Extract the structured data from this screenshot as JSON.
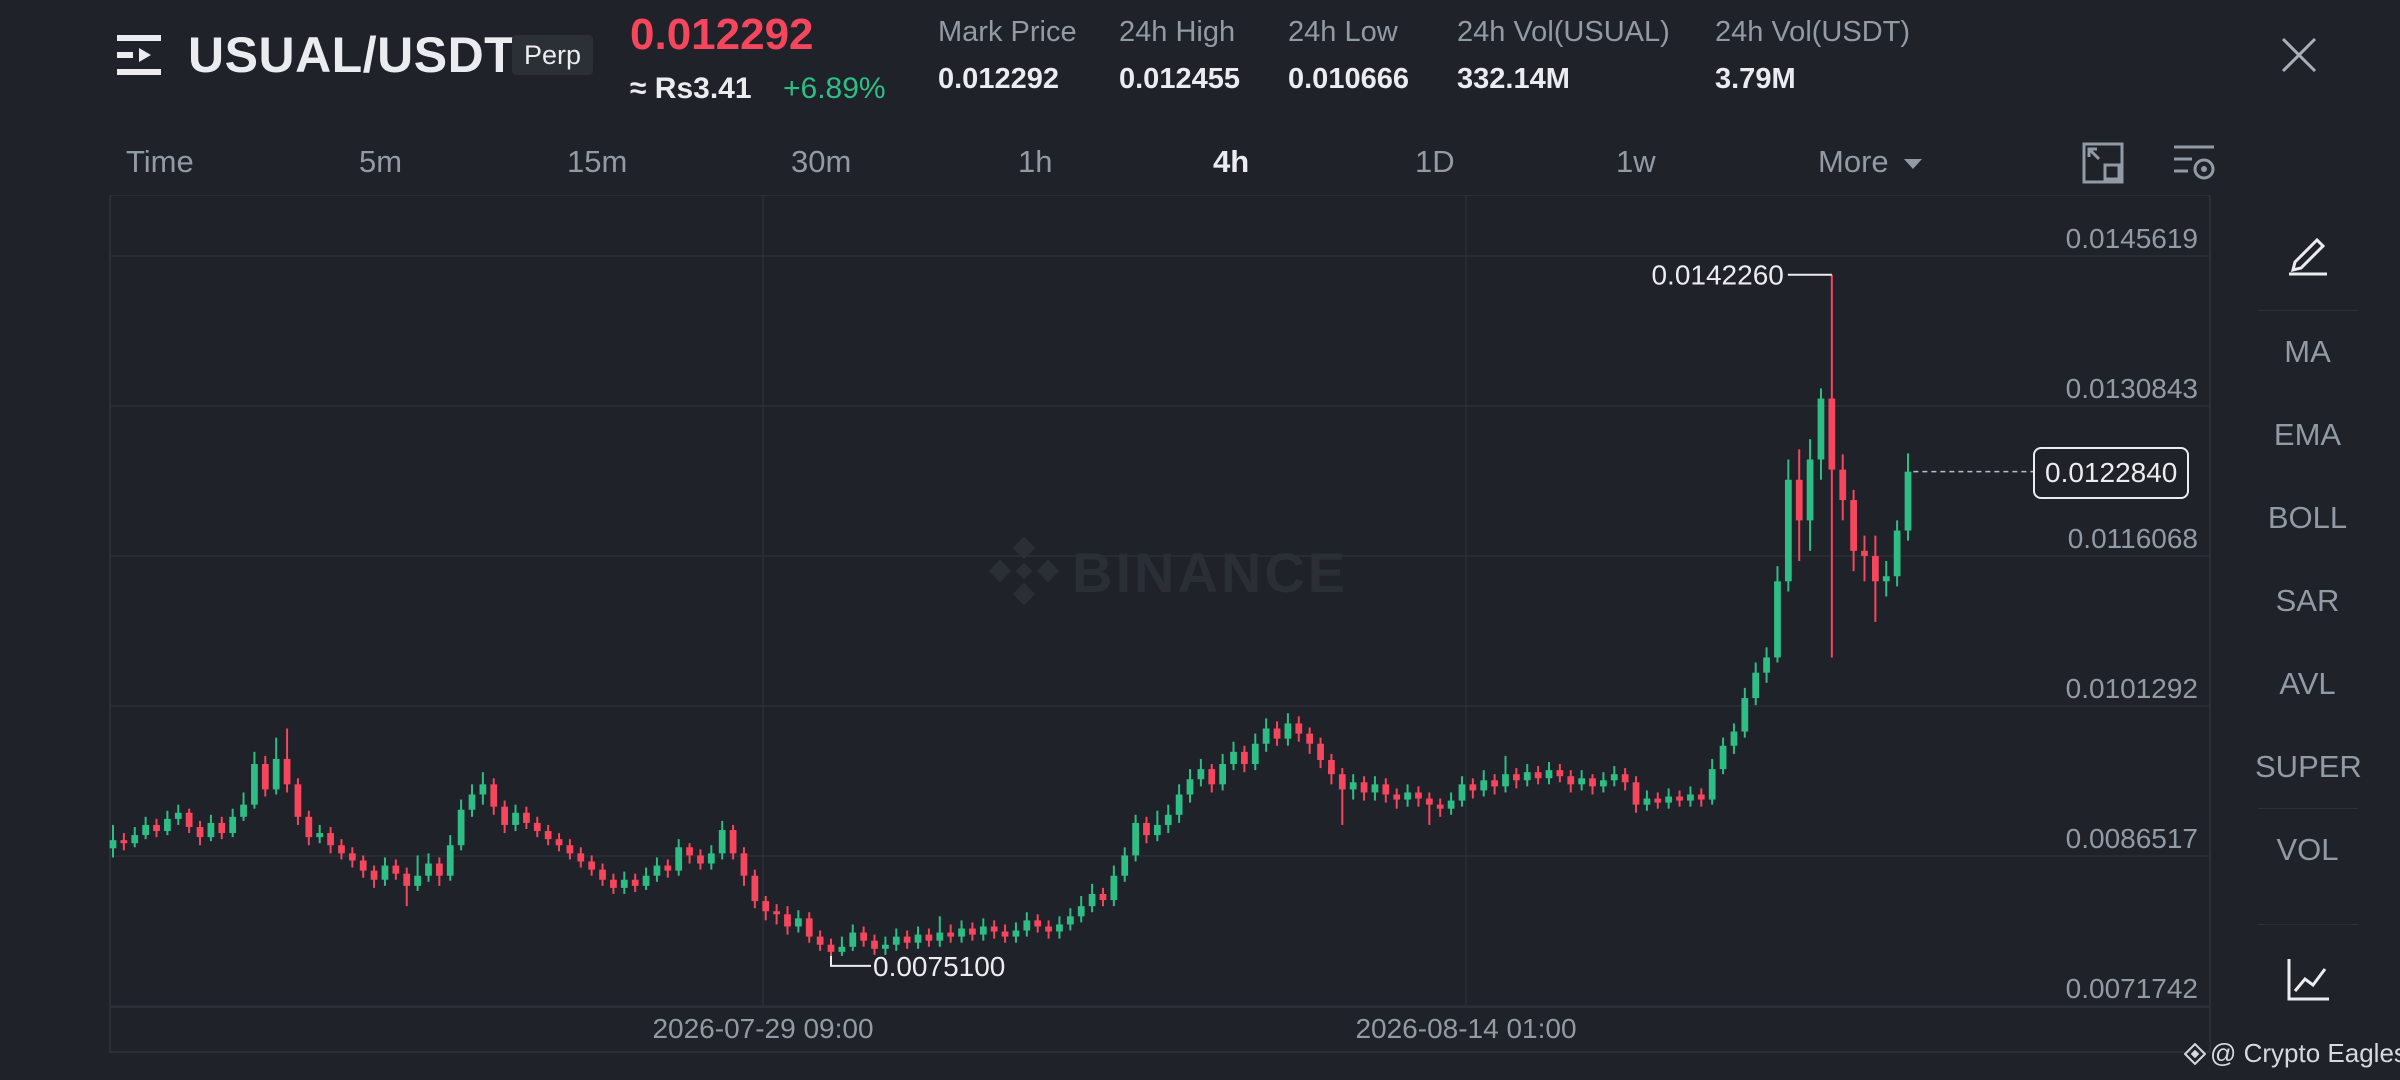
{
  "header": {
    "pair": "USUAL/USDT",
    "contract_badge": "Perp",
    "last_price": "0.012292",
    "fiat_price": "≈ Rs3.41",
    "change_pct": "+6.89%",
    "stats": [
      {
        "label": "Mark Price",
        "value": "0.012292"
      },
      {
        "label": "24h High",
        "value": "0.012455"
      },
      {
        "label": "24h Low",
        "value": "0.010666"
      },
      {
        "label": "24h Vol(USUAL)",
        "value": "332.14M"
      },
      {
        "label": "24h Vol(USDT)",
        "value": "3.79M"
      }
    ]
  },
  "timeframes": [
    "Time",
    "5m",
    "15m",
    "30m",
    "1h",
    "4h",
    "1D",
    "1w",
    "More"
  ],
  "active_timeframe": "4h",
  "indicators": [
    "MA",
    "EMA",
    "BOLL",
    "SAR",
    "AVL",
    "SUPER",
    "VOL"
  ],
  "icons": {
    "menu": "menu-icon",
    "close": "close-icon",
    "fullscreen": "fullscreen-icon",
    "chart_settings": "chart-settings-icon",
    "draw": "pencil-icon",
    "indicator_chart": "line-chart-icon",
    "dropdown": "caret-down-icon"
  },
  "watermark": {
    "brand": "BINANCE",
    "credit": "@ Crypto Eagles"
  },
  "colors": {
    "background": "#1f2229",
    "up": "#2ebd85",
    "down": "#f6465d",
    "text_primary": "#eaecef",
    "text_secondary": "#929aa5",
    "grid": "#2b2f36"
  },
  "chart_data": {
    "type": "candlestick",
    "interval": "4h",
    "y_ticks": [
      "0.0145619",
      "0.0130843",
      "0.0116068",
      "0.0101292",
      "0.0086517",
      "0.0071742"
    ],
    "ylim": [
      0.0067,
      0.015
    ],
    "x_ticks": [
      "2026-07-29 09:00",
      "2026-08-14 01:00"
    ],
    "current_price_label": "0.0122840",
    "max_label": "0.0142260",
    "min_label": "0.0075100",
    "candles": [
      [
        0.00857,
        0.00865,
        0.0088,
        0.00848
      ],
      [
        0.00865,
        0.00862,
        0.00872,
        0.00855
      ],
      [
        0.00862,
        0.0087,
        0.00878,
        0.00858
      ],
      [
        0.0087,
        0.0088,
        0.00888,
        0.00866
      ],
      [
        0.0088,
        0.00874,
        0.00886,
        0.00868
      ],
      [
        0.00874,
        0.00886,
        0.00894,
        0.0087
      ],
      [
        0.00886,
        0.00892,
        0.009,
        0.0088
      ],
      [
        0.00892,
        0.00878,
        0.00896,
        0.00872
      ],
      [
        0.00878,
        0.00868,
        0.00884,
        0.0086
      ],
      [
        0.00868,
        0.00882,
        0.0089,
        0.00864
      ],
      [
        0.00882,
        0.00872,
        0.00888,
        0.00866
      ],
      [
        0.00872,
        0.00888,
        0.00896,
        0.00868
      ],
      [
        0.00888,
        0.009,
        0.00912,
        0.00884
      ],
      [
        0.009,
        0.0094,
        0.00952,
        0.00896
      ],
      [
        0.0094,
        0.00915,
        0.00948,
        0.00908
      ],
      [
        0.00915,
        0.00945,
        0.00966,
        0.0091
      ],
      [
        0.00945,
        0.0092,
        0.00975,
        0.00912
      ],
      [
        0.0092,
        0.00888,
        0.00926,
        0.0088
      ],
      [
        0.00888,
        0.00868,
        0.00894,
        0.0086
      ],
      [
        0.00868,
        0.00872,
        0.0088,
        0.00862
      ],
      [
        0.00872,
        0.0086,
        0.00878,
        0.00852
      ],
      [
        0.0086,
        0.00852,
        0.00866,
        0.00846
      ],
      [
        0.00852,
        0.00845,
        0.00858,
        0.00838
      ],
      [
        0.00845,
        0.00835,
        0.0085,
        0.00828
      ],
      [
        0.00835,
        0.00826,
        0.0084,
        0.00818
      ],
      [
        0.00826,
        0.0084,
        0.00848,
        0.0082
      ],
      [
        0.0084,
        0.00832,
        0.00846,
        0.00826
      ],
      [
        0.00832,
        0.0082,
        0.00838,
        0.008
      ],
      [
        0.0082,
        0.0083,
        0.0085,
        0.00815
      ],
      [
        0.0083,
        0.00842,
        0.00852,
        0.00824
      ],
      [
        0.00842,
        0.0083,
        0.00848,
        0.0082
      ],
      [
        0.0083,
        0.0086,
        0.0087,
        0.00825
      ],
      [
        0.0086,
        0.00895,
        0.00905,
        0.00855
      ],
      [
        0.00895,
        0.0091,
        0.0092,
        0.00888
      ],
      [
        0.0091,
        0.0092,
        0.00932,
        0.009
      ],
      [
        0.0092,
        0.00898,
        0.00926,
        0.0089
      ],
      [
        0.00898,
        0.0088,
        0.00904,
        0.00872
      ],
      [
        0.0088,
        0.00892,
        0.009,
        0.00874
      ],
      [
        0.00892,
        0.00882,
        0.00898,
        0.00876
      ],
      [
        0.00882,
        0.00874,
        0.00888,
        0.00868
      ],
      [
        0.00874,
        0.00866,
        0.0088,
        0.0086
      ],
      [
        0.00866,
        0.0086,
        0.00872,
        0.00854
      ],
      [
        0.0086,
        0.00852,
        0.00866,
        0.00846
      ],
      [
        0.00852,
        0.00844,
        0.00858,
        0.00838
      ],
      [
        0.00844,
        0.00836,
        0.0085,
        0.0083
      ],
      [
        0.00836,
        0.00826,
        0.00842,
        0.0082
      ],
      [
        0.00826,
        0.00818,
        0.00832,
        0.00812
      ],
      [
        0.00818,
        0.00826,
        0.00834,
        0.00812
      ],
      [
        0.00826,
        0.0082,
        0.00832,
        0.00814
      ],
      [
        0.0082,
        0.0083,
        0.00838,
        0.00816
      ],
      [
        0.0083,
        0.0084,
        0.00848,
        0.00824
      ],
      [
        0.0084,
        0.00835,
        0.00846,
        0.00828
      ],
      [
        0.00835,
        0.00858,
        0.00866,
        0.0083
      ],
      [
        0.00858,
        0.0085,
        0.00862,
        0.00842
      ],
      [
        0.0085,
        0.00842,
        0.00856,
        0.00836
      ],
      [
        0.00842,
        0.00852,
        0.0086,
        0.00836
      ],
      [
        0.00852,
        0.00875,
        0.00884,
        0.00846
      ],
      [
        0.00875,
        0.00852,
        0.0088,
        0.00846
      ],
      [
        0.00852,
        0.0083,
        0.00858,
        0.0082
      ],
      [
        0.0083,
        0.00805,
        0.00836,
        0.00798
      ],
      [
        0.00805,
        0.00795,
        0.0081,
        0.00786
      ],
      [
        0.00795,
        0.00792,
        0.00802,
        0.00782
      ],
      [
        0.00792,
        0.0078,
        0.008,
        0.00772
      ],
      [
        0.0078,
        0.00788,
        0.00796,
        0.00774
      ],
      [
        0.00788,
        0.0077,
        0.00794,
        0.00764
      ],
      [
        0.0077,
        0.00762,
        0.00776,
        0.00756
      ],
      [
        0.00762,
        0.00755,
        0.00768,
        0.00751
      ],
      [
        0.00755,
        0.0076,
        0.0077,
        0.00751
      ],
      [
        0.0076,
        0.00774,
        0.00782,
        0.00756
      ],
      [
        0.00774,
        0.00766,
        0.0078,
        0.0076
      ],
      [
        0.00766,
        0.00758,
        0.00772,
        0.00752
      ],
      [
        0.00758,
        0.00762,
        0.0077,
        0.00752
      ],
      [
        0.00762,
        0.0077,
        0.00778,
        0.00756
      ],
      [
        0.0077,
        0.00764,
        0.00776,
        0.00758
      ],
      [
        0.00764,
        0.00772,
        0.0078,
        0.00758
      ],
      [
        0.00772,
        0.00766,
        0.00778,
        0.0076
      ],
      [
        0.00766,
        0.00774,
        0.0079,
        0.0076
      ],
      [
        0.00774,
        0.0077,
        0.00782,
        0.00764
      ],
      [
        0.0077,
        0.00778,
        0.00786,
        0.00764
      ],
      [
        0.00778,
        0.00772,
        0.00784,
        0.00766
      ],
      [
        0.00772,
        0.0078,
        0.00788,
        0.00766
      ],
      [
        0.0078,
        0.00775,
        0.00786,
        0.00768
      ],
      [
        0.00775,
        0.0077,
        0.00782,
        0.00764
      ],
      [
        0.0077,
        0.00776,
        0.00784,
        0.00764
      ],
      [
        0.00776,
        0.00786,
        0.00794,
        0.0077
      ],
      [
        0.00786,
        0.0078,
        0.00792,
        0.00774
      ],
      [
        0.0078,
        0.00775,
        0.00786,
        0.00768
      ],
      [
        0.00775,
        0.00782,
        0.0079,
        0.00768
      ],
      [
        0.00782,
        0.0079,
        0.00798,
        0.00776
      ],
      [
        0.0079,
        0.008,
        0.0081,
        0.00784
      ],
      [
        0.008,
        0.00812,
        0.00822,
        0.00794
      ],
      [
        0.00812,
        0.00806,
        0.00818,
        0.008
      ],
      [
        0.00806,
        0.0083,
        0.0084,
        0.008
      ],
      [
        0.0083,
        0.0085,
        0.00858,
        0.00824
      ],
      [
        0.0085,
        0.00882,
        0.0089,
        0.00844
      ],
      [
        0.00882,
        0.0087,
        0.00888,
        0.00862
      ],
      [
        0.0087,
        0.0088,
        0.00894,
        0.00864
      ],
      [
        0.0088,
        0.0089,
        0.009,
        0.00872
      ],
      [
        0.0089,
        0.0091,
        0.0092,
        0.00882
      ],
      [
        0.0091,
        0.00925,
        0.00935,
        0.00902
      ],
      [
        0.00925,
        0.00935,
        0.00945,
        0.00918
      ],
      [
        0.00935,
        0.0092,
        0.0094,
        0.00912
      ],
      [
        0.0092,
        0.0094,
        0.0095,
        0.00914
      ],
      [
        0.0094,
        0.00952,
        0.00962,
        0.00934
      ],
      [
        0.00952,
        0.0094,
        0.00958,
        0.00932
      ],
      [
        0.0094,
        0.0096,
        0.0097,
        0.00934
      ],
      [
        0.0096,
        0.00975,
        0.00985,
        0.00952
      ],
      [
        0.00975,
        0.00965,
        0.00982,
        0.00958
      ],
      [
        0.00965,
        0.0098,
        0.0099,
        0.00958
      ],
      [
        0.0098,
        0.0097,
        0.00987,
        0.00962
      ],
      [
        0.0097,
        0.0096,
        0.00976,
        0.0095
      ],
      [
        0.0096,
        0.00944,
        0.00966,
        0.00936
      ],
      [
        0.00944,
        0.0093,
        0.0095,
        0.0092
      ],
      [
        0.0093,
        0.00915,
        0.00936,
        0.0088
      ],
      [
        0.00915,
        0.00922,
        0.0093,
        0.00905
      ],
      [
        0.00922,
        0.00912,
        0.00928,
        0.00904
      ],
      [
        0.00912,
        0.0092,
        0.00928,
        0.00904
      ],
      [
        0.0092,
        0.0091,
        0.00926,
        0.00902
      ],
      [
        0.0091,
        0.00905,
        0.00916,
        0.00896
      ],
      [
        0.00905,
        0.00912,
        0.0092,
        0.00898
      ],
      [
        0.00912,
        0.00906,
        0.00918,
        0.00898
      ],
      [
        0.00906,
        0.009,
        0.00912,
        0.0088
      ],
      [
        0.009,
        0.00896,
        0.00906,
        0.00888
      ],
      [
        0.00896,
        0.00904,
        0.00912,
        0.0089
      ],
      [
        0.00904,
        0.0092,
        0.00928,
        0.00898
      ],
      [
        0.0092,
        0.00914,
        0.00926,
        0.00906
      ],
      [
        0.00914,
        0.00924,
        0.00934,
        0.00908
      ],
      [
        0.00924,
        0.00918,
        0.0093,
        0.0091
      ],
      [
        0.00918,
        0.0093,
        0.00948,
        0.00912
      ],
      [
        0.0093,
        0.00924,
        0.00936,
        0.00916
      ],
      [
        0.00924,
        0.00932,
        0.0094,
        0.00918
      ],
      [
        0.00932,
        0.00926,
        0.00938,
        0.0092
      ],
      [
        0.00926,
        0.00934,
        0.00942,
        0.0092
      ],
      [
        0.00934,
        0.00928,
        0.0094,
        0.00922
      ],
      [
        0.00928,
        0.0092,
        0.00934,
        0.00912
      ],
      [
        0.0092,
        0.00926,
        0.00934,
        0.00914
      ],
      [
        0.00926,
        0.00918,
        0.0093,
        0.0091
      ],
      [
        0.00918,
        0.00924,
        0.00932,
        0.00912
      ],
      [
        0.00924,
        0.0093,
        0.00938,
        0.00918
      ],
      [
        0.0093,
        0.00922,
        0.00936,
        0.00914
      ],
      [
        0.00922,
        0.009,
        0.00928,
        0.00892
      ],
      [
        0.009,
        0.00906,
        0.00914,
        0.00894
      ],
      [
        0.00906,
        0.00902,
        0.00912,
        0.00896
      ],
      [
        0.00902,
        0.00908,
        0.00916,
        0.00896
      ],
      [
        0.00908,
        0.00904,
        0.00914,
        0.00898
      ],
      [
        0.00904,
        0.0091,
        0.00918,
        0.00898
      ],
      [
        0.0091,
        0.00905,
        0.00916,
        0.00898
      ],
      [
        0.00905,
        0.00935,
        0.00945,
        0.009
      ],
      [
        0.00935,
        0.00958,
        0.00966,
        0.0093
      ],
      [
        0.00958,
        0.00972,
        0.0098,
        0.0095
      ],
      [
        0.00972,
        0.01005,
        0.01015,
        0.00966
      ],
      [
        0.01005,
        0.0103,
        0.0104,
        0.00998
      ],
      [
        0.0103,
        0.01045,
        0.01055,
        0.0102
      ],
      [
        0.01045,
        0.0112,
        0.01135,
        0.0104
      ],
      [
        0.0112,
        0.0122,
        0.0124,
        0.0111
      ],
      [
        0.0122,
        0.0118,
        0.0125,
        0.0114
      ],
      [
        0.0118,
        0.0124,
        0.0126,
        0.0115
      ],
      [
        0.0124,
        0.013,
        0.0131,
        0.0122
      ],
      [
        0.013,
        0.0123,
        0.01422,
        0.01045
      ],
      [
        0.0123,
        0.012,
        0.01245,
        0.0118
      ],
      [
        0.012,
        0.0115,
        0.0121,
        0.0113
      ],
      [
        0.0115,
        0.01145,
        0.01165,
        0.0112
      ],
      [
        0.01145,
        0.0112,
        0.01165,
        0.0108
      ],
      [
        0.0112,
        0.01125,
        0.0114,
        0.01105
      ],
      [
        0.01125,
        0.0117,
        0.0118,
        0.01115
      ],
      [
        0.0117,
        0.01228,
        0.01246,
        0.0116
      ]
    ]
  }
}
